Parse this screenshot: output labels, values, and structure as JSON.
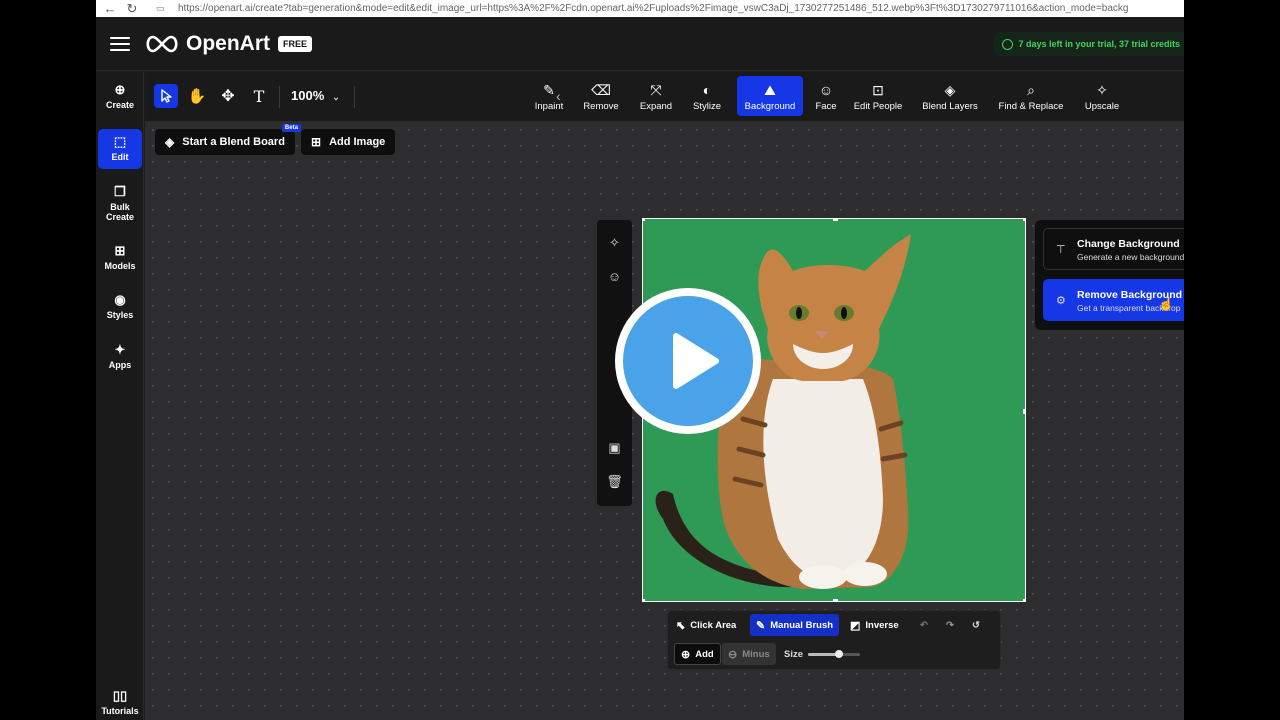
{
  "browser": {
    "url": "https://openart.ai/create?tab=generation&mode=edit&edit_image_url=https%3A%2F%2Fcdn.openart.ai%2Fuploads%2Fimage_vswC3aDj_1730277251486_512.webp%3Ft%3D1730279711016&action_mode=backg"
  },
  "header": {
    "brand": "OpenArt",
    "plan_badge": "FREE",
    "trial_text": "7 days left in your trial,  37 trial credits"
  },
  "left_nav": {
    "items": [
      {
        "label": "Create",
        "icon": "create-icon"
      },
      {
        "label": "Edit",
        "icon": "edit-icon",
        "active": true
      },
      {
        "label": "Bulk Create",
        "icon": "bulk-create-icon"
      },
      {
        "label": "Models",
        "icon": "models-icon"
      },
      {
        "label": "Styles",
        "icon": "styles-icon"
      },
      {
        "label": "Apps",
        "icon": "apps-icon"
      }
    ],
    "footer": {
      "label": "Tutorials",
      "icon": "tutorials-icon"
    }
  },
  "toolbar": {
    "zoom": "100%",
    "features": [
      {
        "label": "Inpaint",
        "icon": "inpaint-icon"
      },
      {
        "label": "Remove",
        "icon": "eraser-icon"
      },
      {
        "label": "Expand",
        "icon": "expand-icon"
      },
      {
        "label": "Stylize",
        "icon": "palette-icon"
      },
      {
        "label": "Background",
        "icon": "background-icon",
        "active": true
      },
      {
        "label": "Face",
        "icon": "face-icon"
      },
      {
        "label": "Edit People",
        "icon": "edit-people-icon"
      },
      {
        "label": "Blend Layers",
        "icon": "layers-icon"
      },
      {
        "label": "Find & Replace",
        "icon": "search-icon"
      },
      {
        "label": "Upscale",
        "icon": "upscale-icon"
      }
    ]
  },
  "canvas": {
    "blend_board_label": "Start a Blend Board",
    "beta_badge": "Beta",
    "add_image_label": "Add Image"
  },
  "background_panel": {
    "options": [
      {
        "title": "Change Background",
        "subtitle": "Generate a new background"
      },
      {
        "title": "Remove Background",
        "subtitle": "Get a transparent backdrop",
        "selected": true
      }
    ]
  },
  "brush_bar": {
    "click_area": "Click Area",
    "manual_brush": "Manual Brush",
    "inverse": "Inverse",
    "add": "Add",
    "minus": "Minus",
    "size_label": "Size",
    "size_value": 0.6
  },
  "colors": {
    "accent": "#1537e6",
    "image_background": "#2e9a56",
    "trial_text": "#3fd45d",
    "play_button": "#4aa2e8"
  }
}
